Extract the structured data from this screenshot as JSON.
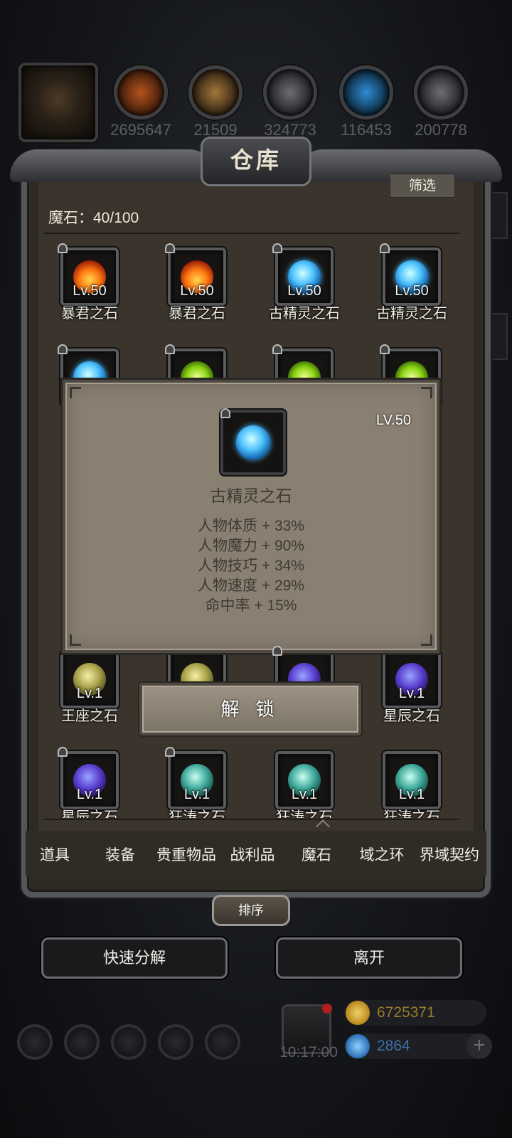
{
  "resources": [
    {
      "icon": "meat-icon",
      "count": "2695647",
      "color": "#b5531c"
    },
    {
      "icon": "wood-icon",
      "count": "21509",
      "color": "#a4763a"
    },
    {
      "icon": "stone-icon",
      "count": "324773",
      "color": "#6c6e72"
    },
    {
      "icon": "crystal-icon",
      "count": "116453",
      "color": "#2e8dd6"
    },
    {
      "icon": "iron-icon",
      "count": "200778",
      "color": "#6e6f73"
    }
  ],
  "warehouse": {
    "title": "仓库",
    "filter_label": "筛选",
    "count_text": "魔石：40/100"
  },
  "items": [
    {
      "level": "Lv.50",
      "name": "暴君之石",
      "gem": "fire"
    },
    {
      "level": "Lv.50",
      "name": "暴君之石",
      "gem": "fire"
    },
    {
      "level": "Lv.50",
      "name": "古精灵之石",
      "gem": "blue"
    },
    {
      "level": "Lv.50",
      "name": "古精灵之石",
      "gem": "blue"
    },
    {
      "level": "Lv.1",
      "name": "王座之石",
      "gem": "yellow"
    },
    {
      "level": "Lv.1",
      "name": "星辰之石",
      "gem": "purple"
    },
    {
      "level": "Lv.1",
      "name": "星辰之石",
      "gem": "purple"
    },
    {
      "level": "Lv.1",
      "name": "狂涛之石",
      "gem": "teal"
    },
    {
      "level": "Lv.1",
      "name": "狂涛之石",
      "gem": "teal"
    },
    {
      "level": "Lv.1",
      "name": "狂涛之石",
      "gem": "teal"
    }
  ],
  "tabs": [
    "道具",
    "装备",
    "贵重物品",
    "战利品",
    "魔石",
    "域之环",
    "界域契约"
  ],
  "active_tab": "魔石",
  "sort_label": "排序",
  "actions": {
    "quick_decompose": "快速分解",
    "leave": "离开"
  },
  "popup": {
    "level": "LV.50",
    "name": "古精灵之石",
    "stats": [
      "人物体质 + 33%",
      "人物魔力 + 90%",
      "人物技巧 + 34%",
      "人物速度 + 29%",
      "命中率 + 15%"
    ],
    "unlock_label": "解 锁"
  },
  "status": {
    "time": "10:17:00",
    "gold": "6725371",
    "gems": "2864",
    "gold_color": "#d9a526",
    "gem_color": "#3a8fe0"
  }
}
